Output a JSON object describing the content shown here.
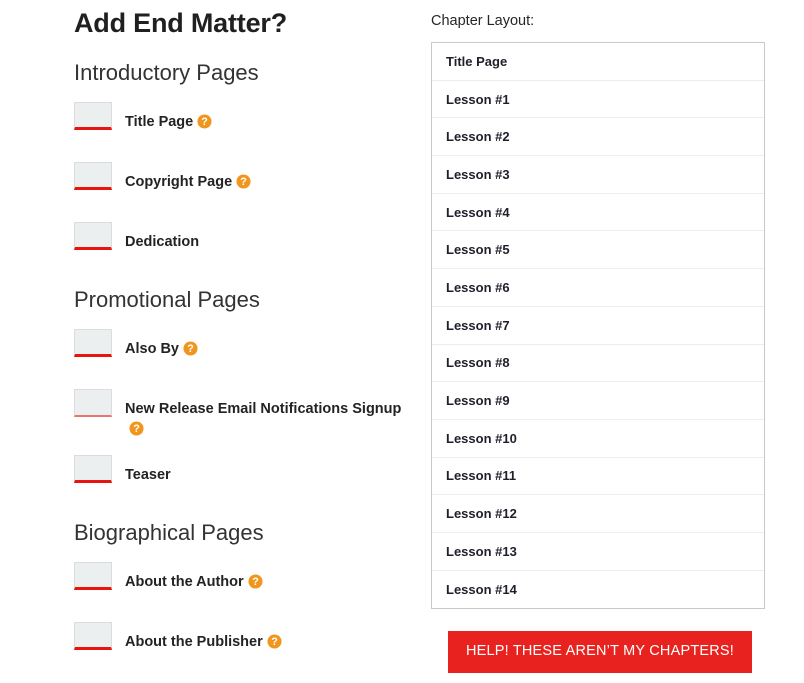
{
  "page_title": "Add End Matter?",
  "colors": {
    "accent_red": "#e8231f",
    "underline_red": "#e8140f",
    "underline_red_faded": "#e8756f",
    "help_orange": "#f0961e",
    "checkbox_fill": "#eceff0"
  },
  "sections": [
    {
      "header": "Introductory Pages",
      "items": [
        {
          "label": "Title Page",
          "has_help": true,
          "faded_underline": false
        },
        {
          "label": "Copyright Page",
          "has_help": true,
          "faded_underline": false
        },
        {
          "label": "Dedication",
          "has_help": false,
          "faded_underline": false
        }
      ]
    },
    {
      "header": "Promotional Pages",
      "items": [
        {
          "label": "Also By",
          "has_help": true,
          "faded_underline": false
        },
        {
          "label": "New Release Email Notifications Signup",
          "has_help": true,
          "faded_underline": true
        },
        {
          "label": "Teaser",
          "has_help": false,
          "faded_underline": false
        }
      ]
    },
    {
      "header": "Biographical Pages",
      "items": [
        {
          "label": "About the Author",
          "has_help": true,
          "faded_underline": false
        },
        {
          "label": "About the Publisher",
          "has_help": true,
          "faded_underline": false
        }
      ]
    }
  ],
  "chapter_panel": {
    "label": "Chapter Layout:",
    "rows": [
      "Title Page",
      "Lesson #1",
      "Lesson #2",
      "Lesson #3",
      "Lesson #4",
      "Lesson #5",
      "Lesson #6",
      "Lesson #7",
      "Lesson #8",
      "Lesson #9",
      "Lesson #10",
      "Lesson #11",
      "Lesson #12",
      "Lesson #13",
      "Lesson #14"
    ],
    "help_button_label": "HELP! THESE AREN’T MY CHAPTERS!"
  },
  "icons": {
    "help": "help-circle-icon",
    "checkbox": "checkbox-icon"
  }
}
